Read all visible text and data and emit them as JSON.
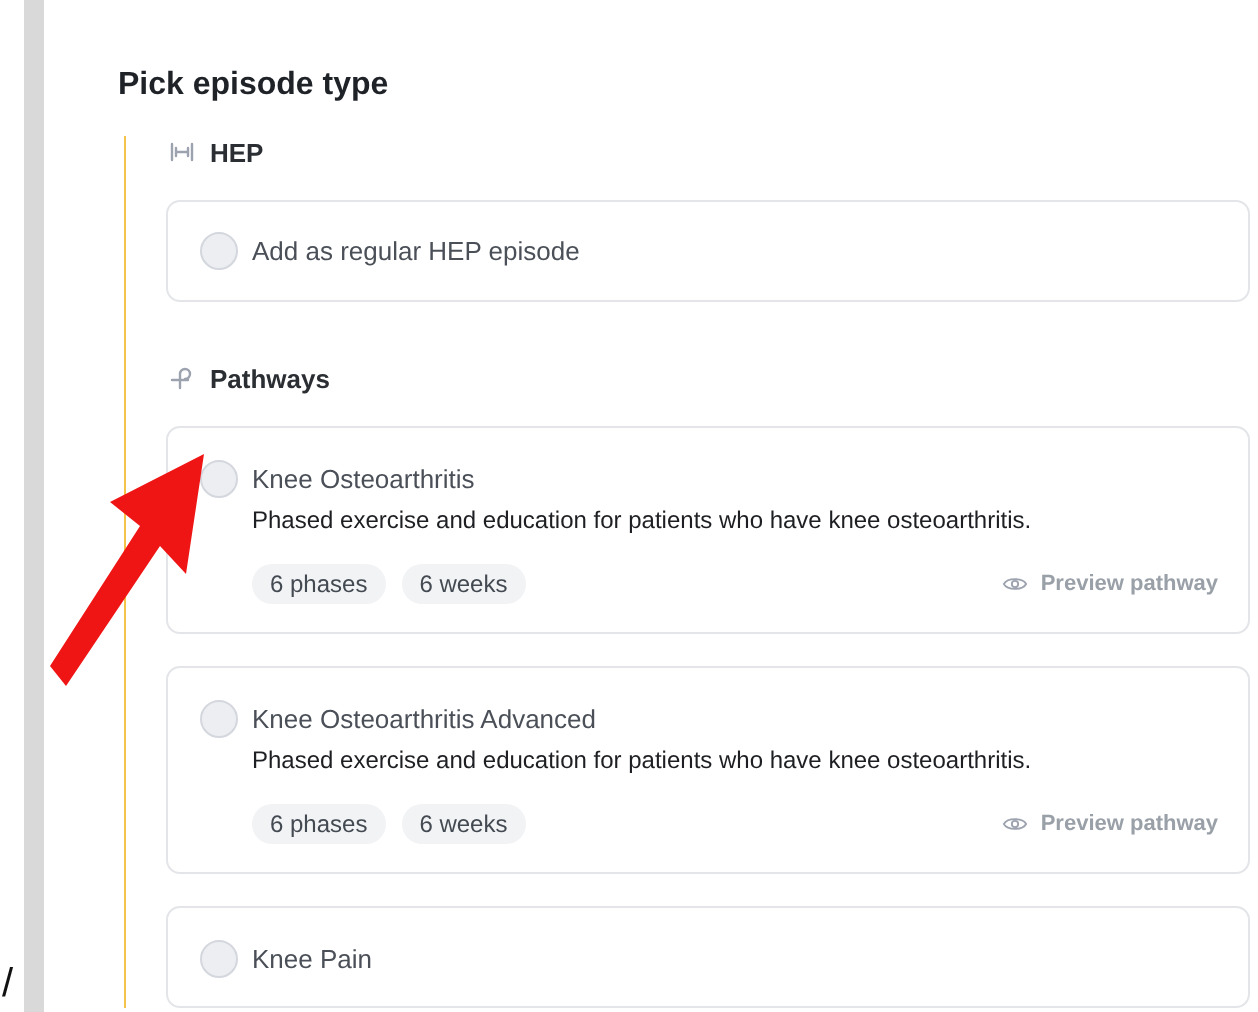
{
  "title": "Pick episode type",
  "sections": [
    {
      "kind": "hep",
      "heading": "HEP",
      "options": [
        {
          "kind": "simple",
          "title": "Add as regular HEP episode",
          "selected": false
        }
      ]
    },
    {
      "kind": "pathways",
      "heading": "Pathways",
      "options": [
        {
          "kind": "pathway",
          "title": "Knee Osteoarthritis",
          "description": "Phased exercise and education for patients who have knee osteoarthritis.",
          "tags": [
            "6 phases",
            "6 weeks"
          ],
          "action": "Preview pathway",
          "selected": false
        },
        {
          "kind": "pathway",
          "title": "Knee Osteoarthritis Advanced",
          "description": "Phased exercise and education for patients who have knee osteoarthritis.",
          "tags": [
            "6 phases",
            "6 weeks"
          ],
          "action": "Preview pathway",
          "selected": false
        },
        {
          "kind": "pathway",
          "title": "Knee Pain",
          "selected": false
        }
      ]
    }
  ],
  "edge_text": "/"
}
